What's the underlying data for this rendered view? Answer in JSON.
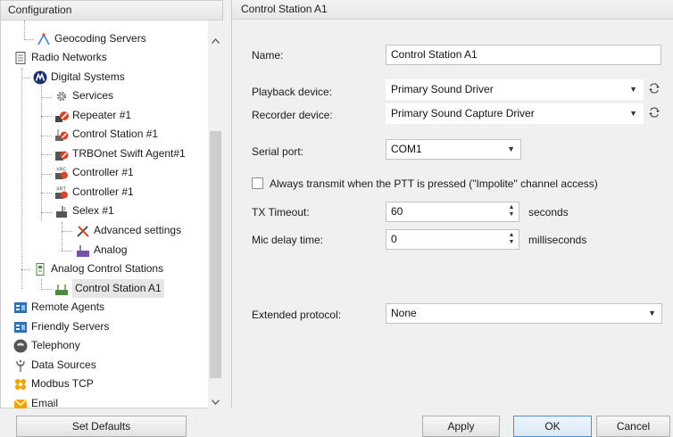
{
  "left_panel": {
    "header": "Configuration",
    "tree": [
      {
        "label": "Geocoding Servers",
        "icon": "geocoding-icon"
      },
      {
        "label": "Radio Networks",
        "icon": "document-icon"
      },
      {
        "label": "Digital Systems",
        "icon": "motorola-logo-icon"
      },
      {
        "label": "Services",
        "icon": "gear-icon"
      },
      {
        "label": "Repeater #1",
        "icon": "repeater-icon"
      },
      {
        "label": "Control Station #1",
        "icon": "control-station-icon"
      },
      {
        "label": "TRBOnet Swift Agent#1",
        "icon": "swift-agent-icon"
      },
      {
        "label": "Controller #1",
        "icon": "controller-xrc-icon",
        "badge": "XRC"
      },
      {
        "label": "Controller #1",
        "icon": "controller-xrt-icon",
        "badge": "XRT"
      },
      {
        "label": "Selex #1",
        "icon": "selex-icon"
      },
      {
        "label": "Advanced settings",
        "icon": "tools-icon"
      },
      {
        "label": "Analog",
        "icon": "analog-icon"
      },
      {
        "label": "Analog Control Stations",
        "icon": "analog-stations-icon"
      },
      {
        "label": "Control Station A1",
        "icon": "control-station-a1-icon"
      },
      {
        "label": "Remote Agents",
        "icon": "remote-agents-icon"
      },
      {
        "label": "Friendly Servers",
        "icon": "friendly-servers-icon"
      },
      {
        "label": "Telephony",
        "icon": "telephony-icon"
      },
      {
        "label": "Data Sources",
        "icon": "data-sources-icon"
      },
      {
        "label": "Modbus TCP",
        "icon": "modbus-icon"
      },
      {
        "label": "Email",
        "icon": "email-icon"
      }
    ]
  },
  "right_panel": {
    "header": "Control Station A1",
    "name": {
      "label": "Name:",
      "value": "Control Station A1"
    },
    "playback": {
      "label": "Playback device:",
      "value": "Primary Sound Driver"
    },
    "recorder": {
      "label": "Recorder device:",
      "value": "Primary Sound Capture Driver"
    },
    "serial": {
      "label": "Serial port:",
      "value": "COM1"
    },
    "always_transmit": {
      "label": "Always transmit when the PTT is pressed (\"Impolite\" channel access)",
      "checked": false
    },
    "tx_timeout": {
      "label": "TX Timeout:",
      "value": "60",
      "unit": "seconds"
    },
    "mic_delay": {
      "label": "Mic delay time:",
      "value": "0",
      "unit": "milliseconds"
    },
    "extended": {
      "label": "Extended protocol:",
      "value": "None"
    }
  },
  "buttons": {
    "set_defaults": "Set Defaults",
    "apply": "Apply",
    "ok": "OK",
    "cancel": "Cancel"
  },
  "colors": {
    "selection": "#e6e6e6",
    "focus_border": "#4a90d9",
    "motorola_blue": "#1a2f6b",
    "warning_red": "#d9442b"
  }
}
